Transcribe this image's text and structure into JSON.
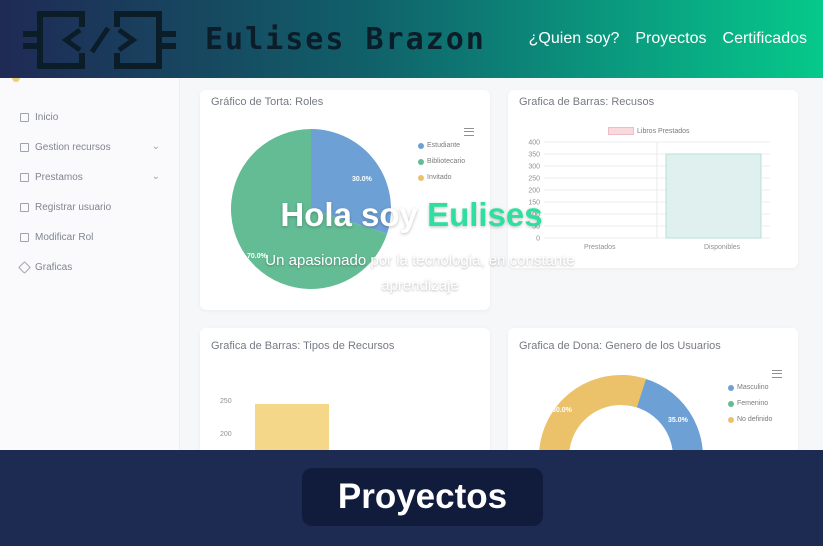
{
  "header": {
    "brand": "Eulises Brazon",
    "nav": [
      "¿Quien soy?",
      "Proyectos",
      "Certificados"
    ]
  },
  "hero": {
    "greeting": "Hola soy ",
    "name": "Eulises",
    "subtitle": "Un apasionado por la tecnologia, en constante aprendizaje"
  },
  "section": {
    "button_label": "Proyectos"
  },
  "dashboard": {
    "sidebar": [
      {
        "label": "Inicio",
        "icon": "grid-icon"
      },
      {
        "label": "Gestion recursos",
        "icon": "folder-icon",
        "expandable": true
      },
      {
        "label": "Prestamos",
        "icon": "plus-box-icon",
        "expandable": true
      },
      {
        "label": "Registrar usuario",
        "icon": "form-icon"
      },
      {
        "label": "Modificar Rol",
        "icon": "list-icon"
      },
      {
        "label": "Graficas",
        "icon": "diamond-icon"
      }
    ],
    "cards": {
      "pie_title": "Gráfico de Torta: Roles",
      "bar1_title": "Grafica de Barras: Recusos",
      "bar2_title": "Grafica de Barras: Tipos de Recursos",
      "donut_title": "Grafica de Dona: Genero de los Usuarios"
    }
  },
  "chart_data": [
    {
      "type": "pie",
      "title": "Gráfico de Torta: Roles",
      "labels": [
        "Estudiante",
        "Bibliotecario",
        "Invitado"
      ],
      "values": [
        30.0,
        70.0,
        0
      ],
      "value_labels": [
        "30.0%",
        "70.0%"
      ],
      "colors": [
        "#1f6fbf",
        "#11995c",
        "#e0a21b"
      ],
      "legend": "right"
    },
    {
      "type": "bar",
      "title": "Grafica de Barras: Recusos",
      "series": [
        {
          "name": "Libros Prestados",
          "values": [
            0,
            350
          ]
        }
      ],
      "categories": [
        "Prestados",
        "Disponibles"
      ],
      "yticks": [
        "400",
        "350",
        "300",
        "250",
        "200",
        "150",
        "100",
        "50",
        "0"
      ],
      "ylim": [
        0,
        400
      ],
      "legend": "top",
      "colors": [
        "#cfe9e6",
        "#f4c6cc"
      ]
    },
    {
      "type": "bar",
      "title": "Grafica de Barras: Tipos de Recursos",
      "visible_values": [
        248
      ],
      "yticks": [
        "250",
        "200"
      ],
      "colors": [
        "#f0c24b"
      ]
    },
    {
      "type": "pie",
      "title": "Grafica de Dona: Genero de los Usuarios",
      "labels": [
        "Masculino",
        "Femenino",
        "No definido"
      ],
      "value_labels": [
        "35.0%",
        "30.0%"
      ],
      "colors": [
        "#1f6fbf",
        "#11995c",
        "#e0a21b"
      ],
      "legend": "right"
    }
  ]
}
